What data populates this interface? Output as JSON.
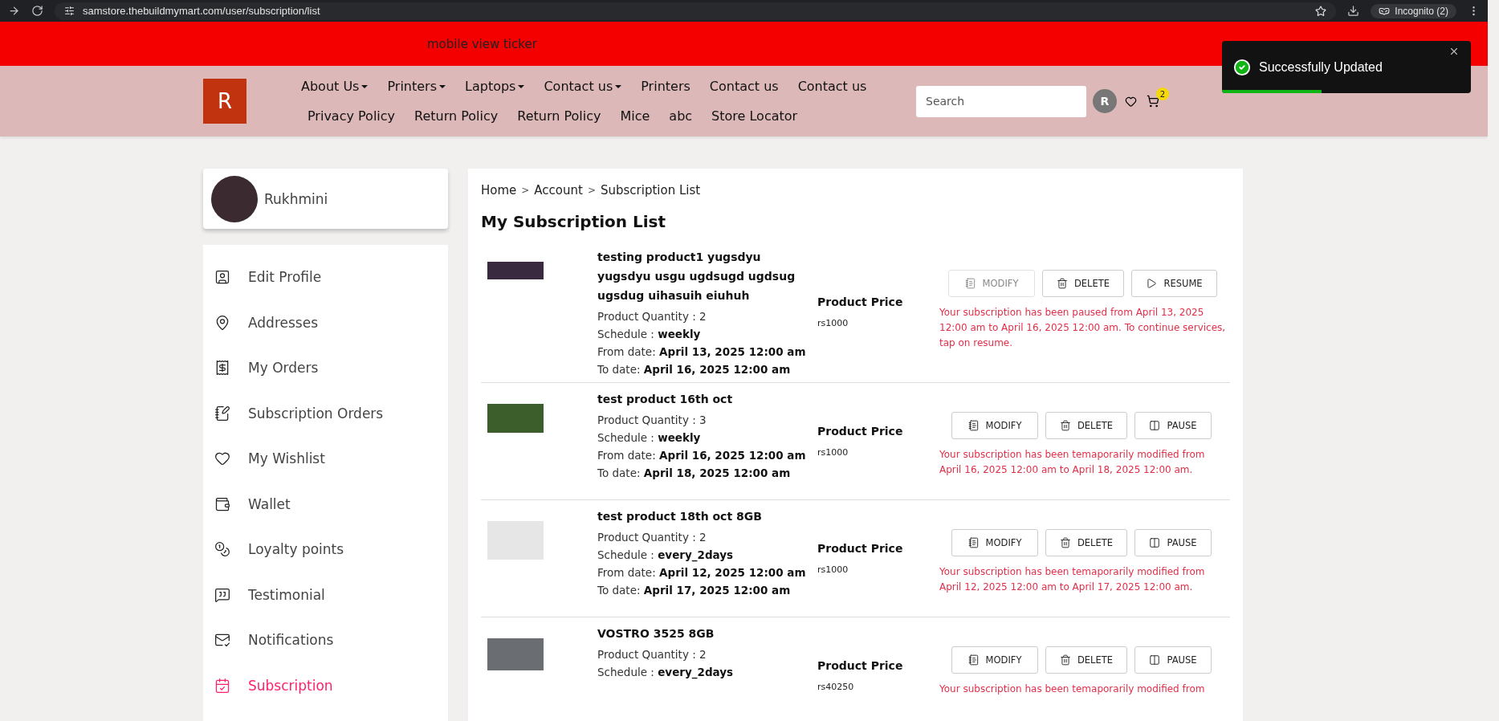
{
  "browser": {
    "url": "samstore.thebuildmymart.com/user/subscription/list",
    "profile": "Incognito (2)"
  },
  "ticker": {
    "text": "mobile view ticker"
  },
  "header": {
    "logo": "R",
    "nav_rows": [
      [
        {
          "label": "About Us",
          "dropdown": true
        },
        {
          "label": "Printers",
          "dropdown": true
        },
        {
          "label": "Laptops",
          "dropdown": true
        },
        {
          "label": "Contact us",
          "dropdown": true
        },
        {
          "label": "Printers",
          "dropdown": false
        },
        {
          "label": "Contact us",
          "dropdown": false
        },
        {
          "label": "Contact us",
          "dropdown": false
        }
      ],
      [
        {
          "label": "Privacy Policy",
          "dropdown": false
        },
        {
          "label": "Return Policy",
          "dropdown": false
        },
        {
          "label": "Return Policy",
          "dropdown": false
        },
        {
          "label": "Mice",
          "dropdown": false
        },
        {
          "label": "abc",
          "dropdown": false
        },
        {
          "label": "Store Locator",
          "dropdown": false
        }
      ]
    ],
    "search": {
      "placeholder": "Search"
    },
    "user_initial": "R",
    "cart_count": "2"
  },
  "toast": {
    "message": "Successfully Updated",
    "level": 0.4
  },
  "sidebar": {
    "user_name": "Rukhmini",
    "items": [
      {
        "label": "Edit Profile",
        "selected": false
      },
      {
        "label": "Addresses",
        "selected": false
      },
      {
        "label": "My Orders",
        "selected": false
      },
      {
        "label": "Subscription Orders",
        "selected": false
      },
      {
        "label": "My Wishlist",
        "selected": false
      },
      {
        "label": "Wallet",
        "selected": false
      },
      {
        "label": "Loyalty points",
        "selected": false
      },
      {
        "label": "Testimonial",
        "selected": false
      },
      {
        "label": "Notifications",
        "selected": false
      },
      {
        "label": "Subscription",
        "selected": true
      }
    ]
  },
  "breadcrumb": [
    {
      "kind": "link",
      "text": "Home"
    },
    {
      "kind": "separator",
      "text": ">"
    },
    {
      "kind": "link",
      "text": "Account"
    },
    {
      "kind": "separator",
      "text": ">"
    },
    {
      "kind": "link",
      "text": "Subscription List"
    }
  ],
  "title": "My Subscription List",
  "subscriptions": [
    {
      "name": "testing product1 yugsdyu yugsdyu usgu ugdsugd ugdsug ugsdug uihasuih eiuhuh",
      "quantity_label": "Product Quantity : 2",
      "schedule_label": "Schedule :",
      "schedule": "weekly",
      "from_label": "From date:",
      "from": "April 13, 2025 12:00 am",
      "to_label": "To date:",
      "to": "April 16, 2025 12:00 am",
      "price_label": "Product Price",
      "price": "rs1000",
      "buttons": [
        {
          "kind": "modify",
          "label": "MODIFY",
          "disabled": true
        },
        {
          "kind": "delete",
          "label": "DELETE",
          "disabled": false
        },
        {
          "kind": "resume",
          "label": "RESUME",
          "disabled": false
        }
      ],
      "message": "Your subscription has been paused from April 13, 2025 12:00 am to April 16, 2025 12:00 am. To continue services, tap on resume."
    },
    {
      "name": "test product 16th oct",
      "quantity_label": "Product Quantity : 3",
      "schedule_label": "Schedule :",
      "schedule": "weekly",
      "from_label": "From date:",
      "from": "April 16, 2025 12:00 am",
      "to_label": "To date:",
      "to": "April 18, 2025 12:00 am",
      "price_label": "Product Price",
      "price": "rs1000",
      "buttons": [
        {
          "kind": "modify",
          "label": "MODIFY",
          "disabled": false
        },
        {
          "kind": "delete",
          "label": "DELETE",
          "disabled": false
        },
        {
          "kind": "pause",
          "label": "PAUSE",
          "disabled": false
        }
      ],
      "message": "Your subscription has been temaporarily modified from April 16, 2025 12:00 am to April 18, 2025 12:00 am."
    },
    {
      "name": "test product 18th oct 8GB",
      "quantity_label": "Product Quantity : 2",
      "schedule_label": "Schedule :",
      "schedule": "every_2days",
      "from_label": "From date:",
      "from": "April 12, 2025 12:00 am",
      "to_label": "To date:",
      "to": "April 17, 2025 12:00 am",
      "price_label": "Product Price",
      "price": "rs1000",
      "buttons": [
        {
          "kind": "modify",
          "label": "MODIFY",
          "disabled": false
        },
        {
          "kind": "delete",
          "label": "DELETE",
          "disabled": false
        },
        {
          "kind": "pause",
          "label": "PAUSE",
          "disabled": false
        }
      ],
      "message": "Your subscription has been temaporarily modified from April 12, 2025 12:00 am to April 17, 2025 12:00 am."
    },
    {
      "name": "VOSTRO 3525 8GB",
      "quantity_label": "Product Quantity : 2",
      "schedule_label": "Schedule :",
      "schedule": "every_2days",
      "price_label": "Product Price",
      "price": "rs40250",
      "buttons": [
        {
          "kind": "modify",
          "label": "MODIFY",
          "disabled": false
        },
        {
          "kind": "delete",
          "label": "DELETE",
          "disabled": false
        },
        {
          "kind": "pause",
          "label": "PAUSE",
          "disabled": false
        }
      ],
      "message": "Your subscription has been temaporarily modified from"
    }
  ]
}
